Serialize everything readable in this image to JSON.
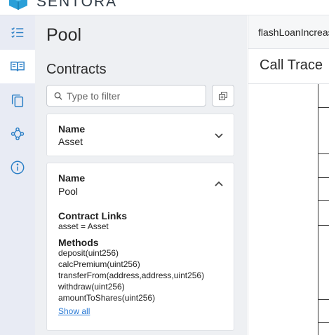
{
  "app": {
    "brand": "SENTORA"
  },
  "rail": {
    "items": [
      {
        "icon": "list-icon",
        "active": false
      },
      {
        "icon": "book-icon",
        "active": true
      },
      {
        "icon": "copy-icon",
        "active": false
      },
      {
        "icon": "share-graph-icon",
        "active": false
      },
      {
        "icon": "info-icon",
        "active": false
      }
    ]
  },
  "panel": {
    "title": "Pool",
    "section": "Contracts",
    "filter_placeholder": "Type to filter",
    "cards": [
      {
        "label": "Name",
        "value": "Asset",
        "expanded": false
      },
      {
        "label": "Name",
        "value": "Pool",
        "expanded": true,
        "links_title": "Contract Links",
        "links": [
          "asset = Asset"
        ],
        "methods_title": "Methods",
        "methods": [
          "deposit(uint256)",
          "calcPremium(uint256)",
          "transferFrom(address,address,uint256)",
          "withdraw(uint256)",
          "amountToShares(uint256)"
        ],
        "show_all": "Show all"
      }
    ]
  },
  "right": {
    "tab": "flashLoanIncreas",
    "trace_title": "Call Trace"
  }
}
